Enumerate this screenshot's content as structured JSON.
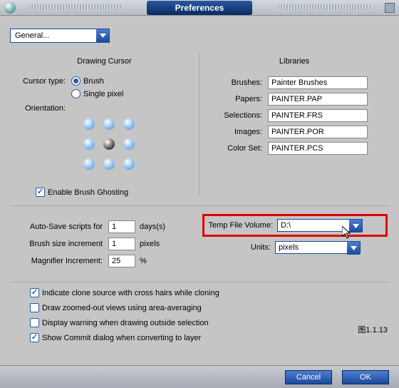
{
  "window": {
    "title": "Preferences"
  },
  "category": "General...",
  "drawingCursor": {
    "heading": "Drawing Cursor",
    "cursorTypeLabel": "Cursor type:",
    "brush": "Brush",
    "singlePixel": "Single pixel",
    "orientationLabel": "Orientation:",
    "enableGhosting": "Enable Brush Ghosting"
  },
  "libraries": {
    "heading": "Libraries",
    "brushesLabel": "Brushes:",
    "brushesValue": "Painter Brushes",
    "papersLabel": "Papers:",
    "papersValue": "PAINTER.PAP",
    "selectionsLabel": "Selections:",
    "selectionsValue": "PAINTER.FRS",
    "imagesLabel": "Images:",
    "imagesValue": "PAINTER.POR",
    "colorSetLabel": "Color Set:",
    "colorSetValue": "PAINTER.PCS"
  },
  "autosave": {
    "label": "Auto-Save scripts for",
    "value": "1",
    "unit": "days(s)"
  },
  "brushInc": {
    "label": "Brush size increment",
    "value": "1",
    "unit": "pixels"
  },
  "magInc": {
    "label": "Magnifier Increment:",
    "value": "25",
    "unit": "%"
  },
  "tempVolume": {
    "label": "Temp File Volume:",
    "value": "D:\\"
  },
  "units": {
    "label": "Units:",
    "value": "pixels"
  },
  "opts": {
    "cloneHairs": "Indicate clone source with cross hairs while cloning",
    "zoomedOut": "Draw zoomed-out views using area-averaging",
    "warnOutside": "Display warning when drawing outside selection",
    "commitDialog": "Show Commit dialog when converting to layer"
  },
  "figureLabel": "图1.1.13",
  "buttons": {
    "cancel": "Cancel",
    "ok": "OK"
  }
}
